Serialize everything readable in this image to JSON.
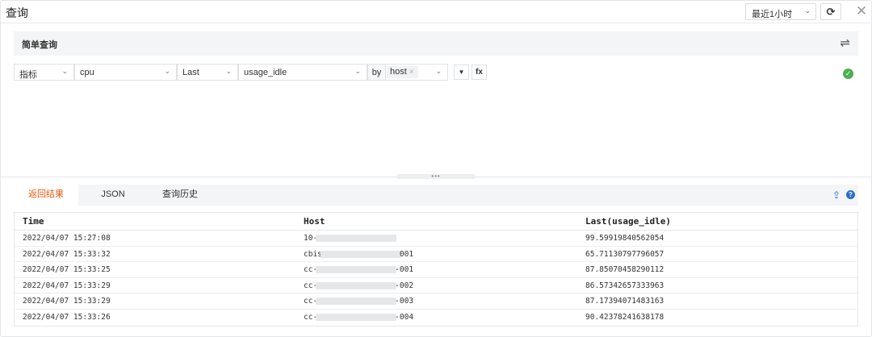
{
  "window": {
    "title": "查询",
    "time_range": "最近1小时",
    "time_chev": "⌄",
    "refresh_glyph": "⟳",
    "close_glyph": "✕"
  },
  "query": {
    "panel_title": "简单查询",
    "swap_glyph": "⇌",
    "metric_type": "指标",
    "measurement": "cpu",
    "aggregation": "Last",
    "field": "usage_idle",
    "by_label": "by",
    "group_tag": "host",
    "tag_remove": "×",
    "filter_glyph": "▼",
    "fx_label": "fx",
    "status_glyph": "✓",
    "chev": "⌄"
  },
  "splitter": {
    "dots": "•••"
  },
  "tabs": [
    {
      "label": "返回结果",
      "active": true
    },
    {
      "label": "JSON",
      "active": false
    },
    {
      "label": "查询历史",
      "active": false
    }
  ],
  "tab_icons": {
    "export_glyph": "⇪",
    "help_glyph": "?"
  },
  "table": {
    "columns": [
      "Time",
      "Host",
      "Last(usage_idle)"
    ],
    "rows": [
      {
        "time": "2022/04/07 15:27:08",
        "host_prefix": "10-",
        "host_suffix": "",
        "value": "99.59919840562054"
      },
      {
        "time": "2022/04/07 15:33:32",
        "host_prefix": "cbis",
        "host_suffix": "001",
        "value": "65.71130797796057"
      },
      {
        "time": "2022/04/07 15:33:25",
        "host_prefix": "cc-",
        "host_suffix": "-001",
        "value": "87.85070458290112"
      },
      {
        "time": "2022/04/07 15:33:29",
        "host_prefix": "cc-",
        "host_suffix": "-002",
        "value": "86.57342657333963"
      },
      {
        "time": "2022/04/07 15:33:29",
        "host_prefix": "cc-",
        "host_suffix": "-003",
        "value": "87.17394071483163"
      },
      {
        "time": "2022/04/07 15:33:26",
        "host_prefix": "cc-",
        "host_suffix": "-004",
        "value": "90.42378241638178"
      }
    ]
  },
  "colors": {
    "accent": "#e8590c",
    "link_blue": "#2a6fc9",
    "success_green": "#4caf50",
    "panel_bg": "#f4f5f7"
  }
}
